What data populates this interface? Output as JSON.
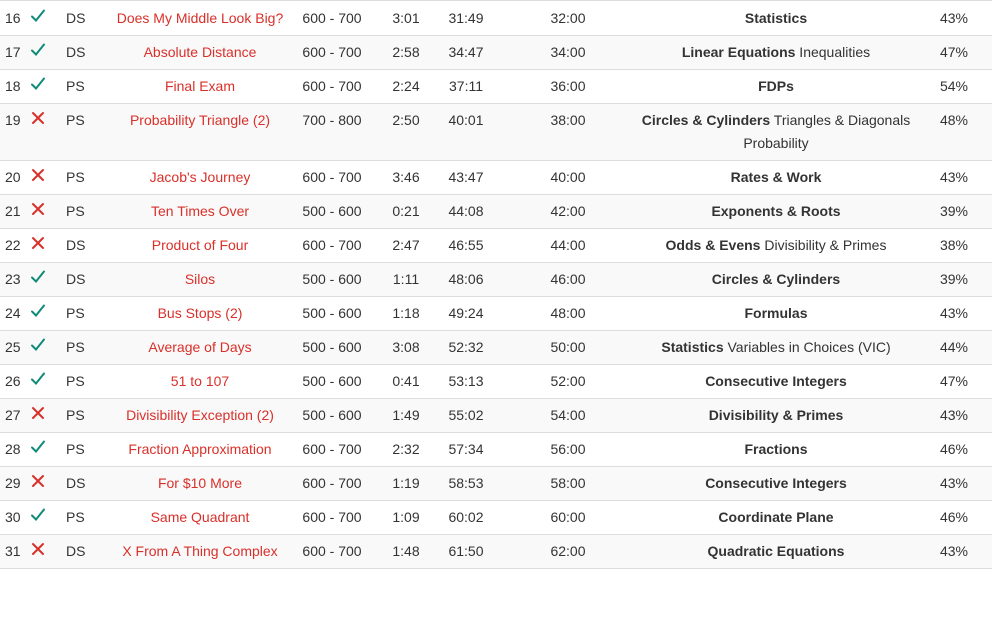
{
  "colors": {
    "correct": "#0f8a78",
    "incorrect": "#d9302a",
    "title_link": "#d9302a",
    "row_alt": "#f9f9f9",
    "divider": "#dddddd"
  },
  "rows": [
    {
      "num": "16",
      "result": "correct",
      "result_icon": "check-icon",
      "type": "DS",
      "title": "Does My Middle Look Big?",
      "difficulty": "600 - 700",
      "time": "3:01",
      "elapsed": "31:49",
      "target": "32:00",
      "topic_main": "Statistics",
      "topic_extra": "",
      "pct": "43%"
    },
    {
      "num": "17",
      "result": "correct",
      "result_icon": "check-icon",
      "type": "DS",
      "title": "Absolute Distance",
      "difficulty": "600 - 700",
      "time": "2:58",
      "elapsed": "34:47",
      "target": "34:00",
      "topic_main": "Linear Equations",
      "topic_extra": " Inequalities",
      "pct": "47%"
    },
    {
      "num": "18",
      "result": "correct",
      "result_icon": "check-icon",
      "type": "PS",
      "title": "Final Exam",
      "difficulty": "600 - 700",
      "time": "2:24",
      "elapsed": "37:11",
      "target": "36:00",
      "topic_main": "FDPs",
      "topic_extra": "",
      "pct": "54%"
    },
    {
      "num": "19",
      "result": "incorrect",
      "result_icon": "cross-icon",
      "type": "PS",
      "title": "Probability Triangle (2)",
      "difficulty": "700 - 800",
      "time": "2:50",
      "elapsed": "40:01",
      "target": "38:00",
      "topic_main": "Circles & Cylinders",
      "topic_extra": " Triangles & Diagonals Probability",
      "pct": "48%"
    },
    {
      "num": "20",
      "result": "incorrect",
      "result_icon": "cross-icon",
      "type": "PS",
      "title": "Jacob's Journey",
      "difficulty": "600 - 700",
      "time": "3:46",
      "elapsed": "43:47",
      "target": "40:00",
      "topic_main": "Rates & Work",
      "topic_extra": "",
      "pct": "43%"
    },
    {
      "num": "21",
      "result": "incorrect",
      "result_icon": "cross-icon",
      "type": "PS",
      "title": "Ten Times Over",
      "difficulty": "500 - 600",
      "time": "0:21",
      "elapsed": "44:08",
      "target": "42:00",
      "topic_main": "Exponents & Roots",
      "topic_extra": "",
      "pct": "39%"
    },
    {
      "num": "22",
      "result": "incorrect",
      "result_icon": "cross-icon",
      "type": "DS",
      "title": "Product of Four",
      "difficulty": "600 - 700",
      "time": "2:47",
      "elapsed": "46:55",
      "target": "44:00",
      "topic_main": "Odds & Evens",
      "topic_extra": " Divisibility & Primes",
      "pct": "38%"
    },
    {
      "num": "23",
      "result": "correct",
      "result_icon": "check-icon",
      "type": "DS",
      "title": "Silos",
      "difficulty": "500 - 600",
      "time": "1:11",
      "elapsed": "48:06",
      "target": "46:00",
      "topic_main": "Circles & Cylinders",
      "topic_extra": "",
      "pct": "39%"
    },
    {
      "num": "24",
      "result": "correct",
      "result_icon": "check-icon",
      "type": "PS",
      "title": "Bus Stops (2)",
      "difficulty": "500 - 600",
      "time": "1:18",
      "elapsed": "49:24",
      "target": "48:00",
      "topic_main": "Formulas",
      "topic_extra": "",
      "pct": "43%"
    },
    {
      "num": "25",
      "result": "correct",
      "result_icon": "check-icon",
      "type": "PS",
      "title": "Average of Days",
      "difficulty": "500 - 600",
      "time": "3:08",
      "elapsed": "52:32",
      "target": "50:00",
      "topic_main": "Statistics",
      "topic_extra": " Variables in Choices (VIC)",
      "pct": "44%"
    },
    {
      "num": "26",
      "result": "correct",
      "result_icon": "check-icon",
      "type": "PS",
      "title": "51 to 107",
      "difficulty": "500 - 600",
      "time": "0:41",
      "elapsed": "53:13",
      "target": "52:00",
      "topic_main": "Consecutive Integers",
      "topic_extra": "",
      "pct": "47%"
    },
    {
      "num": "27",
      "result": "incorrect",
      "result_icon": "cross-icon",
      "type": "PS",
      "title": "Divisibility Exception (2)",
      "difficulty": "500 - 600",
      "time": "1:49",
      "elapsed": "55:02",
      "target": "54:00",
      "topic_main": "Divisibility & Primes",
      "topic_extra": "",
      "pct": "43%"
    },
    {
      "num": "28",
      "result": "correct",
      "result_icon": "check-icon",
      "type": "PS",
      "title": "Fraction Approximation",
      "difficulty": "600 - 700",
      "time": "2:32",
      "elapsed": "57:34",
      "target": "56:00",
      "topic_main": "Fractions",
      "topic_extra": "",
      "pct": "46%"
    },
    {
      "num": "29",
      "result": "incorrect",
      "result_icon": "cross-icon",
      "type": "DS",
      "title": "For $10 More",
      "difficulty": "600 - 700",
      "time": "1:19",
      "elapsed": "58:53",
      "target": "58:00",
      "topic_main": "Consecutive Integers",
      "topic_extra": "",
      "pct": "43%"
    },
    {
      "num": "30",
      "result": "correct",
      "result_icon": "check-icon",
      "type": "PS",
      "title": "Same Quadrant",
      "difficulty": "600 - 700",
      "time": "1:09",
      "elapsed": "60:02",
      "target": "60:00",
      "topic_main": "Coordinate Plane",
      "topic_extra": "",
      "pct": "46%"
    },
    {
      "num": "31",
      "result": "incorrect",
      "result_icon": "cross-icon",
      "type": "DS",
      "title": "X From A Thing Complex",
      "difficulty": "600 - 700",
      "time": "1:48",
      "elapsed": "61:50",
      "target": "62:00",
      "topic_main": "Quadratic Equations",
      "topic_extra": "",
      "pct": "43%"
    }
  ]
}
